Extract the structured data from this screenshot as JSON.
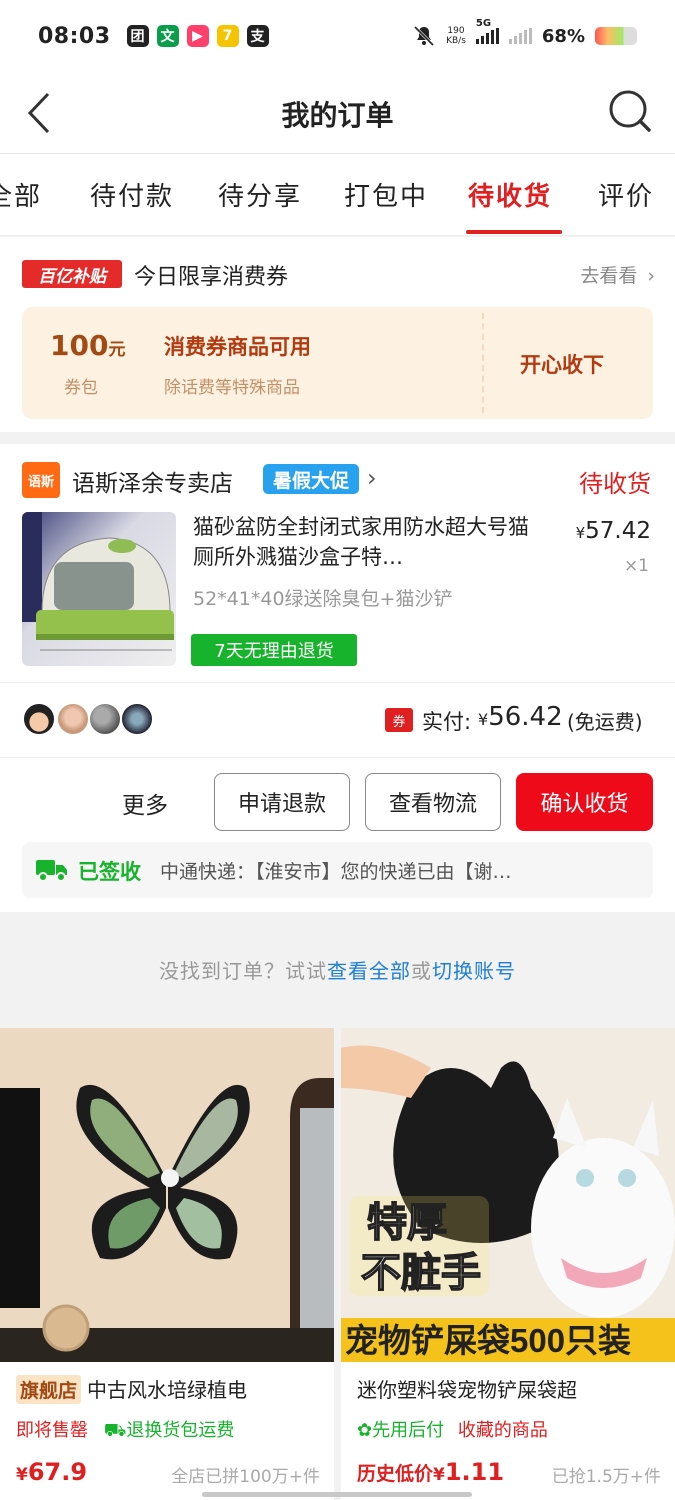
{
  "status_bar": {
    "time": "08:03",
    "net_speed": "190",
    "net_unit": "KB/s",
    "network": "5G",
    "battery": "68%",
    "apps": [
      {
        "icon": "box-app-icon",
        "glyph": "团",
        "color": "#222222"
      },
      {
        "icon": "text-app-icon",
        "glyph": "文",
        "color": "#0a9d4a"
      },
      {
        "icon": "video-app-icon",
        "glyph": "▶",
        "color": "#ff3f6c"
      },
      {
        "icon": "seven-app-icon",
        "glyph": "7",
        "color": "#f5c400"
      },
      {
        "icon": "alipay-app-icon",
        "glyph": "支",
        "color": "#222222"
      }
    ]
  },
  "header": {
    "title": "我的订单",
    "back_icon": "chevron-left-icon",
    "search_icon": "search-icon"
  },
  "tabs": [
    {
      "label": "全部"
    },
    {
      "label": "待付款"
    },
    {
      "label": "待分享"
    },
    {
      "label": "打包中"
    },
    {
      "label": "待收货",
      "active": true
    },
    {
      "label": "评价"
    }
  ],
  "coupon": {
    "badge": "百亿补贴",
    "title": "今日限享消费券",
    "link": "去看看",
    "amount": "100",
    "amount_unit": "元",
    "pack": "券包",
    "desc": "消费券商品可用",
    "sub": "除话费等特殊商品",
    "accept": "开心收下"
  },
  "order": {
    "store_logo": "语斯",
    "store_name": "语斯泽余专卖店",
    "promo": "暑假大促",
    "status": "待收货",
    "product_title": "猫砂盆防全封闭式家用防水超大号猫厕所外溅猫沙盒子特…",
    "spec": "52*41*40绿送除臭包+猫沙铲",
    "return_tag": "7天无理由退货",
    "price_symbol": "¥",
    "price": "57.42",
    "qty": "×1",
    "coupon_tag": "券",
    "paid_label": "实付:",
    "paid_symbol": "¥",
    "paid_amount": "56.42",
    "paid_note": "(免运费)",
    "more": "更多",
    "btn_refund": "申请退款",
    "btn_logistics": "查看物流",
    "btn_confirm": "确认收货",
    "logistics_status": "已签收",
    "logistics_text": "中通快递：【淮安市】您的快递已由【谢…"
  },
  "hint": {
    "prefix": "没找到订单？试试",
    "link1": "查看全部",
    "mid": "或",
    "link2": "切换账号"
  },
  "recommendations": [
    {
      "badge": "旗舰店",
      "title": "中古风水培绿植电",
      "tag1": "即将售罄",
      "tag2": "退换货包运费",
      "price_symbol": "¥",
      "price": "67.9",
      "sold": "全店已拼100万+件"
    },
    {
      "title": "迷你塑料袋宠物铲屎袋超",
      "tag1": "先用后付",
      "tag2": "收藏的商品",
      "price_prefix": "历史低价",
      "price_symbol": "¥",
      "price": "1.11",
      "sold": "已抢1.5万+件",
      "img_text_1": "特厚",
      "img_text_2": "不脏手",
      "img_banner": "宠物铲屎袋500只装"
    }
  ],
  "colors": {
    "accent": "#e02020",
    "green": "#17b32c",
    "link": "#1f7fd6"
  }
}
